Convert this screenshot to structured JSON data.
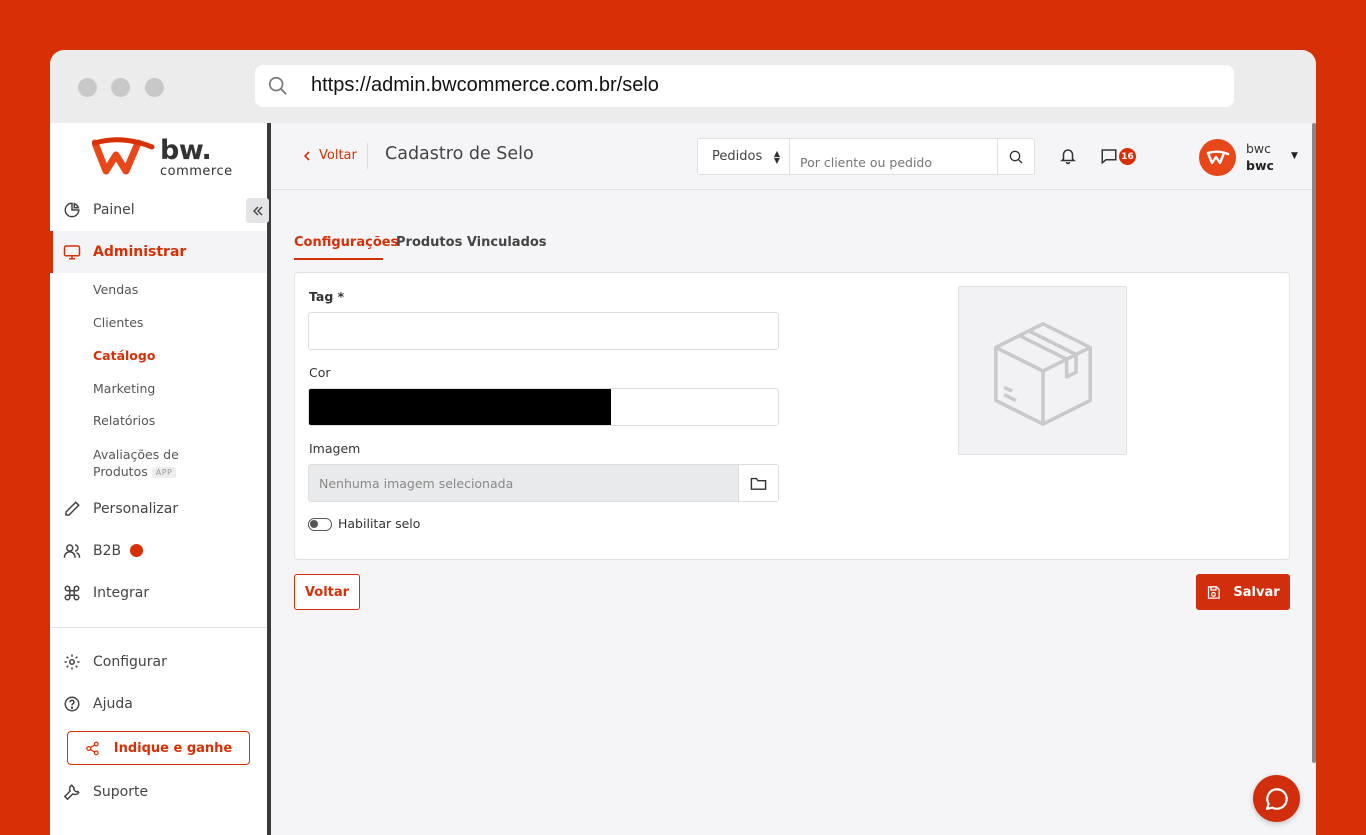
{
  "browser": {
    "url": "https://admin.bwcommerce.com.br/selo"
  },
  "brand": {
    "name": "bw.",
    "sub": "commerce",
    "accent": "#d83006"
  },
  "sidebar": {
    "items": [
      {
        "label": "Painel",
        "icon": "pie-chart-icon"
      },
      {
        "label": "Administrar",
        "icon": "monitor-icon",
        "active": true
      },
      {
        "label": "Personalizar",
        "icon": "pencil-icon"
      },
      {
        "label": "B2B",
        "icon": "users-icon"
      },
      {
        "label": "Integrar",
        "icon": "command-icon"
      },
      {
        "label": "Configurar",
        "icon": "gear-icon"
      },
      {
        "label": "Ajuda",
        "icon": "help-icon"
      },
      {
        "label": "Suporte",
        "icon": "wrench-icon"
      }
    ],
    "subitems": [
      {
        "label": "Vendas"
      },
      {
        "label": "Clientes"
      },
      {
        "label": "Catálogo",
        "active": true
      },
      {
        "label": "Marketing"
      },
      {
        "label": "Relatórios"
      },
      {
        "label": "Avaliações de"
      },
      {
        "label": "Produtos"
      }
    ],
    "app_badge": "APP",
    "indique": "Indique e ganhe"
  },
  "topbar": {
    "back": "Voltar",
    "title": "Cadastro de Selo",
    "search": {
      "select_value": "Pedidos",
      "placeholder": "Por cliente ou pedido"
    },
    "messages_count": "16",
    "user": {
      "name": "bwc",
      "company": "bwc"
    }
  },
  "tabs": [
    {
      "label": "Configurações",
      "active": true
    },
    {
      "label": "Produtos Vinculados",
      "active": false
    }
  ],
  "form": {
    "tag_label": "Tag *",
    "tag_value": "",
    "color_label": "Cor",
    "color_value": "#000000",
    "image_label": "Imagem",
    "image_placeholder": "Nenhuma imagem selecionada",
    "toggle_label": "Habilitar selo",
    "toggle_on": false
  },
  "actions": {
    "back": "Voltar",
    "save": "Salvar"
  }
}
